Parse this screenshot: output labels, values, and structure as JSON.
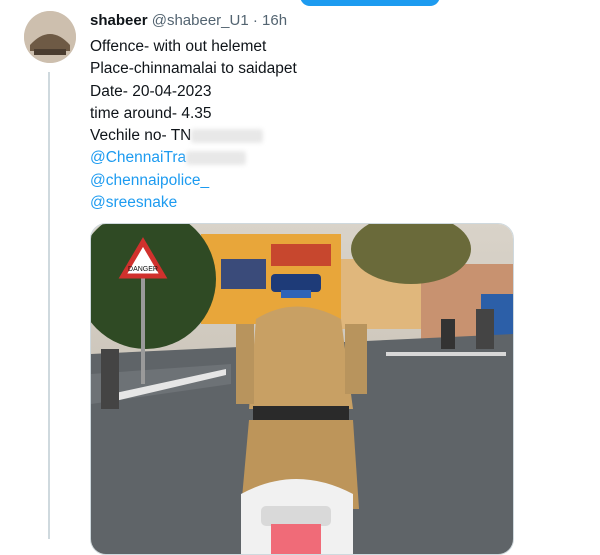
{
  "tweet": {
    "display_name": "shabeer",
    "handle": "@shabeer_U1",
    "separator": "·",
    "time": "16h",
    "lines": [
      "Offence- with out helemet",
      "Place-chinnamalai to saidapet",
      "Date- 20-04-2023",
      "time around- 4.35"
    ],
    "vehicle_prefix": "Vechile no- TN",
    "mentions": [
      "@ChennaiTra",
      "@chennaipolice_",
      "@sreesnake"
    ],
    "photo_sign": "DANGER"
  },
  "colors": {
    "link": "#1d9bf0",
    "muted": "#536471",
    "accent": "#1d9bf0"
  }
}
